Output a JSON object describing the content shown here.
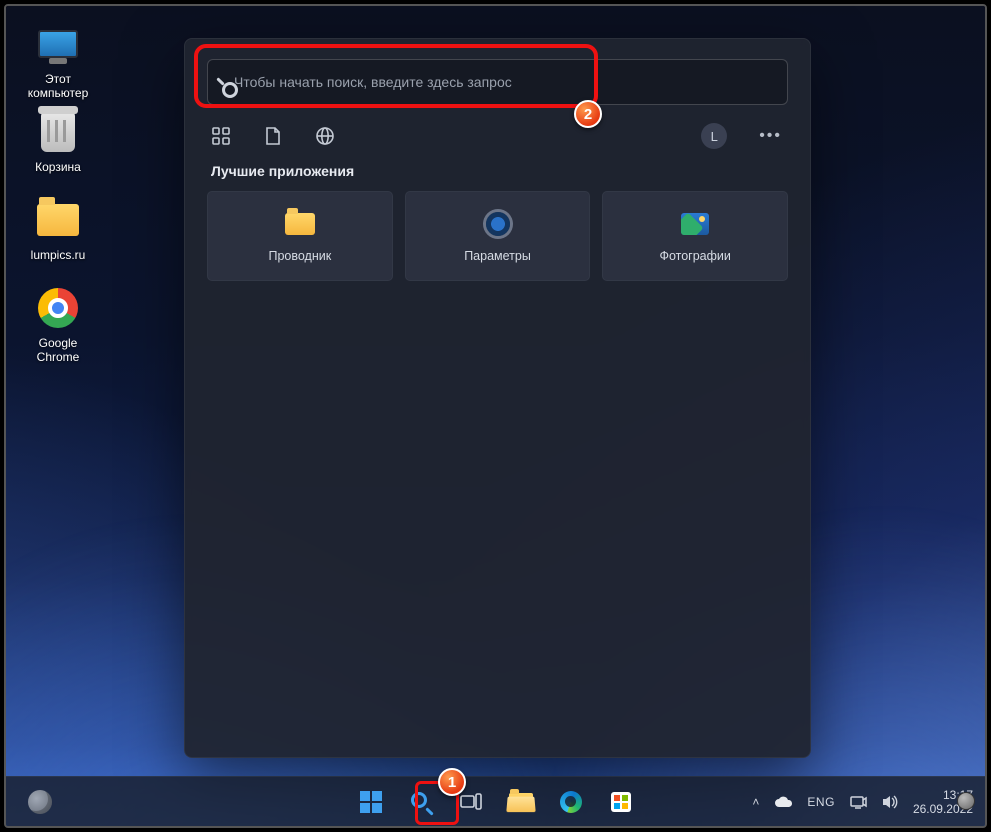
{
  "desktop_icons": {
    "computer": "Этот\nкомпьютер",
    "recycle": "Корзина",
    "folder": "lumpics.ru",
    "chrome": "Google\nChrome"
  },
  "search": {
    "placeholder": "Чтобы начать поиск, введите здесь запрос"
  },
  "flyout": {
    "user_initial": "L",
    "section_title": "Лучшие приложения",
    "tiles": [
      {
        "label": "Проводник"
      },
      {
        "label": "Параметры"
      },
      {
        "label": "Фотографии"
      }
    ]
  },
  "annotations": {
    "badge1": "1",
    "badge2": "2"
  },
  "taskbar": {
    "lang": "ENG",
    "time": "13:17",
    "date": "26.09.2022"
  }
}
